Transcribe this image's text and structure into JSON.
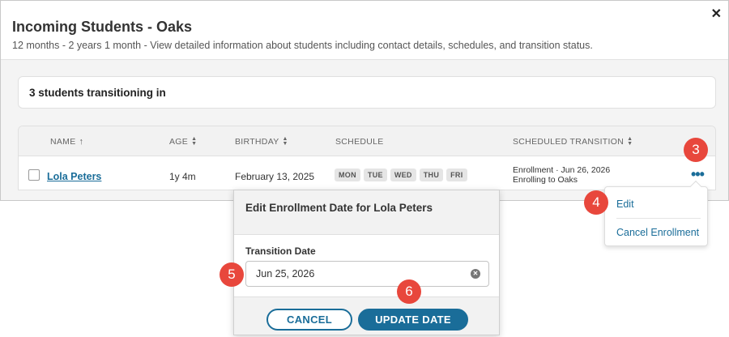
{
  "modal": {
    "title": "Incoming Students - Oaks",
    "close_glyph": "✕",
    "subtitle": "12 months - 2 years 1 month - View detailed information about students including contact details, schedules, and transition status."
  },
  "summary": {
    "count_label": "3 students transitioning in"
  },
  "table": {
    "headers": {
      "name": "NAME",
      "age": "AGE",
      "birthday": "BIRTHDAY",
      "schedule": "SCHEDULE",
      "transition": "SCHEDULED TRANSITION"
    },
    "row": {
      "name": "Lola Peters",
      "age": "1y 4m",
      "birthday": "February 13, 2025",
      "days": [
        "MON",
        "TUE",
        "WED",
        "THU",
        "FRI"
      ],
      "transition_line1": "Enrollment · Jun 26, 2026",
      "transition_line2": "Enrolling to Oaks"
    }
  },
  "menu": {
    "edit": "Edit",
    "cancel_enrollment": "Cancel Enrollment"
  },
  "popover": {
    "title": "Edit Enrollment Date for Lola Peters",
    "label": "Transition Date",
    "date_value": "Jun 25, 2026",
    "cancel": "CANCEL",
    "update": "UPDATE DATE"
  },
  "badges": {
    "b3": "3",
    "b4": "4",
    "b5": "5",
    "b6": "6"
  },
  "colors": {
    "accent": "#1a6d99",
    "badge": "#e8473c"
  }
}
